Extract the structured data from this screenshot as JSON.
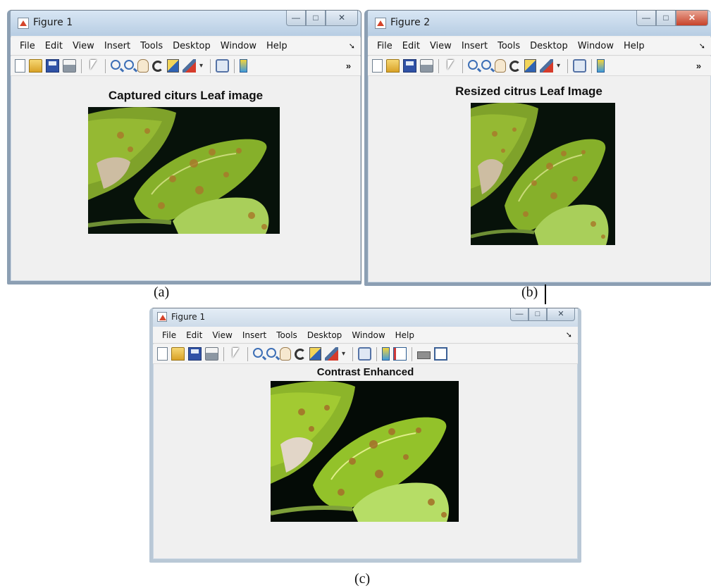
{
  "windows": [
    {
      "title": "Figure 1",
      "menu": [
        "File",
        "Edit",
        "View",
        "Insert",
        "Tools",
        "Desktop",
        "Window",
        "Help"
      ],
      "plot_title": "Captured citurs Leaf  image",
      "caption": "(a)"
    },
    {
      "title": "Figure 2",
      "menu": [
        "File",
        "Edit",
        "View",
        "Insert",
        "Tools",
        "Desktop",
        "Window",
        "Help"
      ],
      "plot_title": "Resized citrus Leaf Image",
      "caption": "(b)"
    },
    {
      "title": "Figure 1",
      "menu": [
        "File",
        "Edit",
        "View",
        "Insert",
        "Tools",
        "Desktop",
        "Window",
        "Help"
      ],
      "plot_title": "Contrast Enhanced",
      "caption": "(c)"
    }
  ],
  "toolbar_icons": [
    "new-figure-icon",
    "open-file-icon",
    "save-icon",
    "print-icon",
    "pointer-icon",
    "zoom-in-icon",
    "zoom-out-icon",
    "pan-icon",
    "rotate-3d-icon",
    "data-cursor-icon",
    "brush-icon",
    "link-plot-icon",
    "insert-colorbar-icon",
    "insert-legend-icon",
    "hide-plot-tools-icon",
    "show-plot-tools-icon"
  ],
  "window_buttons": {
    "minimize": "—",
    "maximize": "□",
    "close": "✕"
  },
  "toolbar_overflow": "»",
  "menu_overflow": "➘",
  "colors": {
    "titlebar": "#b7cde3",
    "close_active": "#c7432b",
    "figure_bg": "#f0f0f0"
  }
}
